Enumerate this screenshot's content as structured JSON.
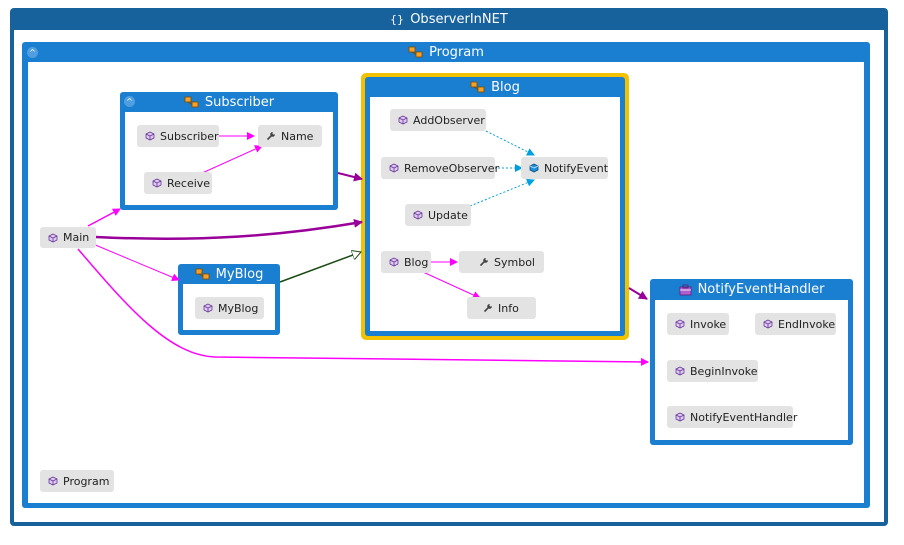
{
  "colors": {
    "frame": "#17619d",
    "group": "#1a7fd0",
    "highlight": "#f2c200",
    "node": "#e3e3e3",
    "edge_call": "#ff00ff",
    "edge_aggregate": "#990099",
    "edge_inherit": "#1b4a14",
    "edge_event": "#00a0e0"
  },
  "namespace": {
    "title": "ObserverInNET",
    "icon": "namespace-braces-icon"
  },
  "program": {
    "title": "Program",
    "icon": "class-icon",
    "members": {
      "main": "Main",
      "program": "Program"
    }
  },
  "subscriber": {
    "title": "Subscriber",
    "icon": "class-icon",
    "members": {
      "subscriber": "Subscriber",
      "name": "Name",
      "receive": "Receive"
    }
  },
  "blog": {
    "title": "Blog",
    "icon": "class-icon",
    "members": {
      "add_observer": "AddObserver",
      "remove_observer": "RemoveObserver",
      "notify_event": "NotifyEvent",
      "update": "Update",
      "blog": "Blog",
      "symbol": "Symbol",
      "info": "Info"
    }
  },
  "myblog": {
    "title": "MyBlog",
    "icon": "class-icon",
    "members": {
      "myblog": "MyBlog"
    }
  },
  "notify_handler": {
    "title": "NotifyEventHandler",
    "icon": "delegate-icon",
    "members": {
      "invoke": "Invoke",
      "end_invoke": "EndInvoke",
      "begin_invoke": "BeginInvoke",
      "notify_event_handler": "NotifyEventHandler"
    }
  }
}
